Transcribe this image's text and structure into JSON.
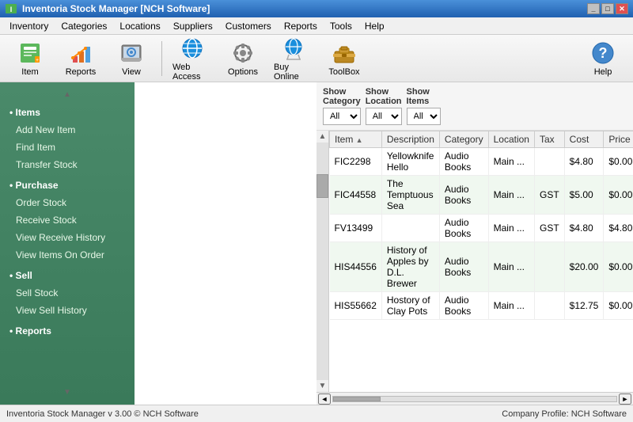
{
  "window": {
    "title": "Inventoria Stock Manager [NCH Software]"
  },
  "menu": {
    "items": [
      "Inventory",
      "Categories",
      "Locations",
      "Suppliers",
      "Customers",
      "Reports",
      "Tools",
      "Help"
    ]
  },
  "toolbar": {
    "buttons": [
      {
        "id": "item",
        "label": "Item",
        "icon": "item-icon"
      },
      {
        "id": "reports",
        "label": "Reports",
        "icon": "reports-icon"
      },
      {
        "id": "view",
        "label": "View",
        "icon": "view-icon"
      },
      {
        "id": "web-access",
        "label": "Web Access",
        "icon": "web-icon"
      },
      {
        "id": "options",
        "label": "Options",
        "icon": "options-icon"
      },
      {
        "id": "buy-online",
        "label": "Buy Online",
        "icon": "buy-icon"
      },
      {
        "id": "toolbox",
        "label": "ToolBox",
        "icon": "toolbox-icon"
      }
    ],
    "help_label": "Help"
  },
  "sidebar": {
    "sections": [
      {
        "title": "Items",
        "links": [
          "Add New Item",
          "Find Item",
          "Transfer Stock"
        ]
      },
      {
        "title": "Purchase",
        "links": [
          "Order Stock",
          "Receive Stock",
          "View Receive History",
          "View Items On Order"
        ]
      },
      {
        "title": "Sell",
        "links": [
          "Sell Stock",
          "View Sell History"
        ]
      },
      {
        "title": "Reports",
        "links": []
      }
    ]
  },
  "filters": {
    "show_category_label": "Show\nCategory",
    "show_location_label": "Show\nLocation",
    "show_items_label": "Show\nItems",
    "category_value": "All",
    "location_value": "All",
    "items_value": "All",
    "options": [
      "All"
    ]
  },
  "table": {
    "columns": [
      "Item",
      "Description",
      "Category",
      "Location",
      "Tax",
      "Cost",
      "Price"
    ],
    "rows": [
      {
        "item": "FIC2298",
        "description": "Yellowknife Hello",
        "category": "Audio Books",
        "location": "Main ...",
        "tax": "",
        "cost": "$4.80",
        "price": "$0.00"
      },
      {
        "item": "FIC44558",
        "description": "The Temptuous Sea",
        "category": "Audio Books",
        "location": "Main ...",
        "tax": "GST",
        "cost": "$5.00",
        "price": "$0.00"
      },
      {
        "item": "FV13499",
        "description": "",
        "category": "Audio Books",
        "location": "Main ...",
        "tax": "GST",
        "cost": "$4.80",
        "price": "$4.80"
      },
      {
        "item": "HIS44556",
        "description": "History of Apples by D.L. Brewer",
        "category": "Audio Books",
        "location": "Main ...",
        "tax": "",
        "cost": "$20.00",
        "price": "$0.00"
      },
      {
        "item": "HIS55662",
        "description": "Hostory of Clay Pots",
        "category": "Audio Books",
        "location": "Main ...",
        "tax": "",
        "cost": "$12.75",
        "price": "$0.00"
      }
    ]
  },
  "status_bar": {
    "left": "Inventoria Stock Manager v 3.00 © NCH Software",
    "right": "Company Profile: NCH Software"
  }
}
